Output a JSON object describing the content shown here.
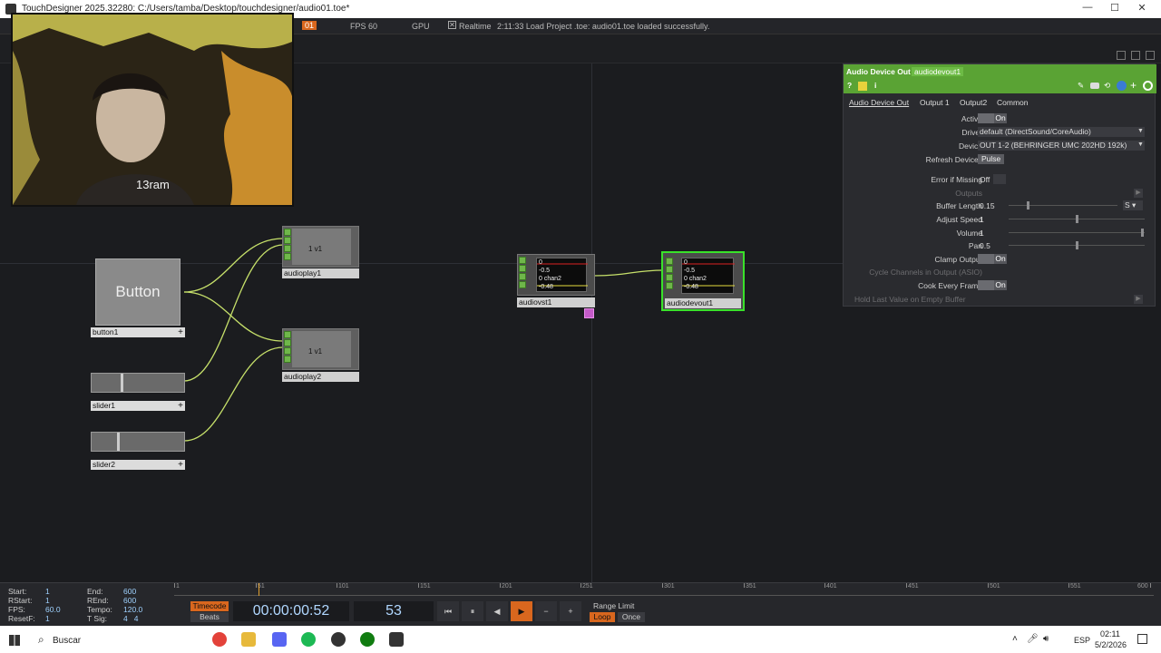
{
  "window": {
    "title": "TouchDesigner 2025.32280: C:/Users/tamba/Desktop/touchdesigner/audio01.toe*",
    "minimize": "—",
    "maximize": "☐",
    "close": "✕"
  },
  "topbar": {
    "badge": "01",
    "fps_label": "FPS",
    "fps_value": "60",
    "gpu_label": "GPU",
    "realtime": "Realtime",
    "status": "2:11:33 Load Project .toe: audio01.toe loaded successfully."
  },
  "webcam": {
    "caption": "13ram"
  },
  "nodes": {
    "button": {
      "face": "Button",
      "name": "button1"
    },
    "slider1": {
      "name": "slider1",
      "level": 0.32
    },
    "slider2": {
      "name": "slider2",
      "level": 0.28
    },
    "audioplay1": {
      "name": "audioplay1",
      "value": "1 v1"
    },
    "audioplay2": {
      "name": "audioplay2",
      "value": "1 v1"
    },
    "audiovst1": {
      "name": "audiovst1",
      "scope_lines": [
        "0",
        "-0.5",
        "0 chan2",
        "-0.48"
      ]
    },
    "audiodevout1": {
      "name": "audiodevout1",
      "scope_lines": [
        "0",
        "-0.5",
        "0 chan2",
        "-0.48"
      ]
    }
  },
  "params": {
    "op_type": "Audio Device Out",
    "op_name": "audiodevout1",
    "tabs": [
      "Audio Device Out",
      "Output 1",
      "Output2",
      "Common"
    ],
    "rows": {
      "active": {
        "label": "Active",
        "value": "On"
      },
      "driver": {
        "label": "Driver",
        "value": "default (DirectSound/CoreAudio)"
      },
      "device": {
        "label": "Device",
        "value": "OUT 1-2 (BEHRINGER UMC 202HD 192k)"
      },
      "refresh": {
        "label": "Refresh Devices",
        "value": "Pulse"
      },
      "error_missing": {
        "label": "Error if Missing",
        "value": "Off"
      },
      "outputs": {
        "label": "Outputs"
      },
      "buffer_length": {
        "label": "Buffer Length",
        "value": "0.15",
        "unit": "S"
      },
      "adjust_speed": {
        "label": "Adjust Speed",
        "value": "1"
      },
      "volume": {
        "label": "Volume",
        "value": "1"
      },
      "pan": {
        "label": "Pan",
        "value": "0.5"
      },
      "clamp": {
        "label": "Clamp Output",
        "value": "On"
      },
      "cycle": {
        "label": "Cycle Channels in Output (ASIO)"
      },
      "cook_every": {
        "label": "Cook Every Frame",
        "value": "On"
      },
      "hold_last": {
        "label": "Hold Last Value on Empty Buffer"
      }
    }
  },
  "timeline": {
    "info": {
      "start": {
        "label": "Start:",
        "value": "1"
      },
      "rstart": {
        "label": "RStart:",
        "value": "1"
      },
      "fps": {
        "label": "FPS:",
        "value": "60.0"
      },
      "resetf": {
        "label": "ResetF:",
        "value": "1"
      },
      "end": {
        "label": "End:",
        "value": "600"
      },
      "rend": {
        "label": "REnd:",
        "value": "600"
      },
      "tempo": {
        "label": "Tempo:",
        "value": "120.0"
      },
      "tsig": {
        "label": "T Sig:",
        "value": "4   4"
      }
    },
    "ticks": [
      "1",
      "51",
      "101",
      "151",
      "201",
      "251",
      "301",
      "351",
      "401",
      "451",
      "501",
      "551",
      "600"
    ],
    "timecode_label": "Timecode",
    "beats_label": "Beats",
    "timecode": "00:00:00:52",
    "frame": "53",
    "range_limit": "Range Limit",
    "loop": "Loop",
    "once": "Once"
  },
  "taskbar": {
    "search": "Buscar",
    "lang": "ESP",
    "time": "02:11",
    "date": "5/2/2026"
  },
  "colors": {
    "node_green": "#6fb74a",
    "param_header": "#5aa334",
    "selected_outline": "#39e22a",
    "wire": "#c6e06a"
  }
}
